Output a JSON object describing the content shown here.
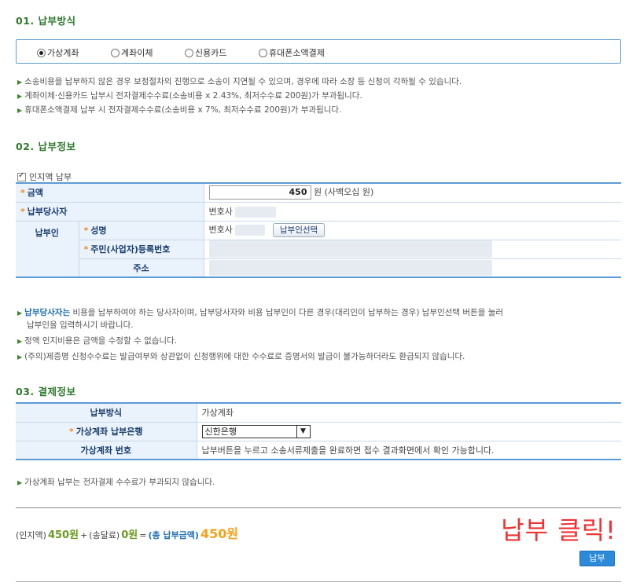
{
  "sections": {
    "s1": "01. 납부방식",
    "s2": "02. 납부정보",
    "s3": "03. 결제정보"
  },
  "payment_methods": [
    {
      "label": "가상계좌",
      "selected": true
    },
    {
      "label": "계좌이체",
      "selected": false
    },
    {
      "label": "신용카드",
      "selected": false
    },
    {
      "label": "휴대폰소액결제",
      "selected": false
    }
  ],
  "notes1": [
    "소송비용을 납부하지 않은 경우 보정절차의 진행으로 소송이 지연될 수 있으며, 경우에 따라 소장 등 신청이 각하될 수 있습니다.",
    "계좌이체·신용카드 납부시 전자결제수수료(소송비용 x 2.43%, 최저수수료 200원)가 부과됩니다.",
    "휴대폰소액결제 납부 시 전자결제수수료(소송비용 x 7%, 최저수수료 200원)가 부과됩니다."
  ],
  "stamp_checkbox": "인지액 납부",
  "info_table": {
    "amount_label": "금액",
    "amount_value": "450",
    "amount_unit": "원 (사백오십 원)",
    "party_label": "납부당사자",
    "party_value": "변호사",
    "payer_label": "납부인",
    "name_label": "성명",
    "name_value": "변호사",
    "select_payer_button": "납부인선택",
    "id_label": "주민(사업자)등록번호",
    "address_label": "주소"
  },
  "notes2": {
    "n1_em": "납부당사자는",
    "n1_rest": " 비용을 납부하여야 하는 당사자이며, 납부당사자와 비용 납부인이 다른 경우(대리인이 납부하는 경우) 납부인선택 버튼을 눌러",
    "n1_cont": "납부인을 입력하시기 바랍니다.",
    "n2": "정액 인지비용은 금액을 수정할 수 없습니다.",
    "n3": "(주의)제증명 신청수수료는 발급여부와 상관없이 신청행위에 대한 수수료로 증명서의 발급이 불가능하더라도 환급되지 않습니다."
  },
  "pay_table": {
    "method_label": "납부방식",
    "method_value": "가상계좌",
    "bank_label": "가상계좌 납부은행",
    "bank_value": "신한은행",
    "account_label": "가상계좌 번호",
    "account_value": "납부버튼을 누르고 소송서류제출을 완료하면 접수 결과화면에서 확인 가능합니다."
  },
  "note3": "가상계좌 납부는 전자결제 수수료가 부과되지 않습니다.",
  "summary": {
    "stamp_label": "(인지액)",
    "stamp_amount": "450원",
    "plus": "+",
    "delivery_label": "(송달료)",
    "delivery_amount": "0원",
    "equals": "=",
    "total_label": "(총 납부금액)",
    "total_amount": "450원"
  },
  "annotation": "납부 클릭!",
  "pay_button": "납부"
}
